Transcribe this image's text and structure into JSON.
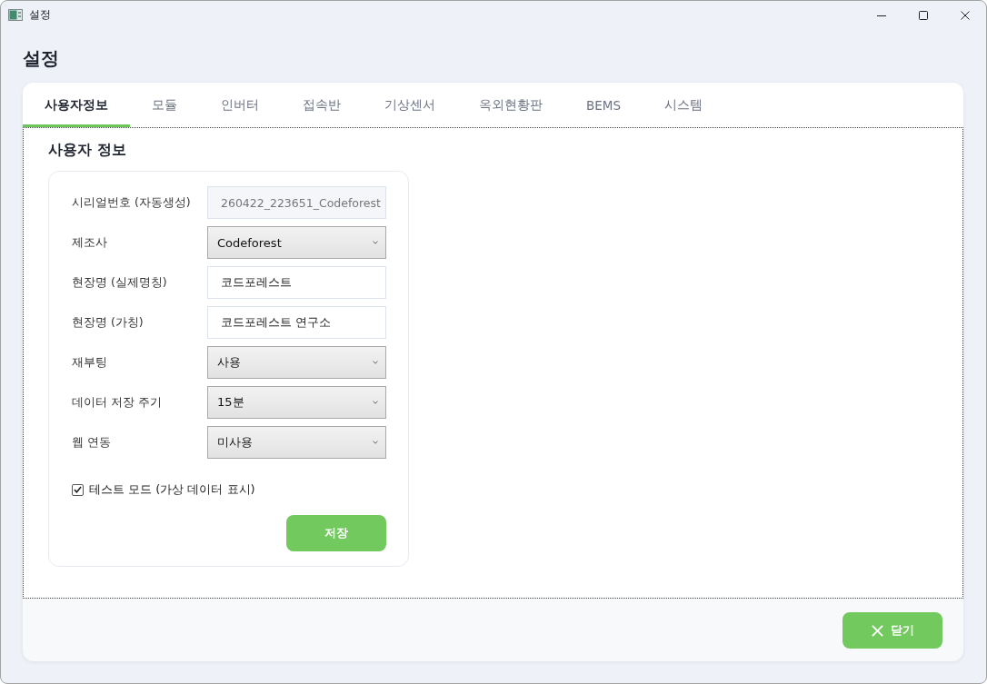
{
  "window": {
    "title": "설정"
  },
  "page_title": "설정",
  "tabs": [
    {
      "label": "사용자정보",
      "selected": true
    },
    {
      "label": "모듈",
      "selected": false
    },
    {
      "label": "인버터",
      "selected": false
    },
    {
      "label": "접속반",
      "selected": false
    },
    {
      "label": "기상센서",
      "selected": false
    },
    {
      "label": "옥외현황판",
      "selected": false
    },
    {
      "label": "BEMS",
      "selected": false
    },
    {
      "label": "시스템",
      "selected": false
    }
  ],
  "section_title": "사용자 정보",
  "form": {
    "fields": [
      {
        "label": "시리얼번호 (자동생성)",
        "kind": "readonly",
        "value": "260422_223651_Codeforest"
      },
      {
        "label": "제조사",
        "kind": "select",
        "value": "Codeforest"
      },
      {
        "label": "현장명 (실제명칭)",
        "kind": "text",
        "value": "코드포레스트"
      },
      {
        "label": "현장명 (가칭)",
        "kind": "text",
        "value": "코드포레스트 연구소"
      },
      {
        "label": "재부팅",
        "kind": "select",
        "value": "사용"
      },
      {
        "label": "데이터 저장 주기",
        "kind": "select",
        "value": "15분"
      },
      {
        "label": "웹 연동",
        "kind": "select",
        "value": "미사용"
      }
    ],
    "test_mode": {
      "label": "테스트 모드 (가상 데이터 표시)",
      "checked": true
    },
    "save_button": "저장"
  },
  "footer": {
    "close_button": "닫기"
  }
}
